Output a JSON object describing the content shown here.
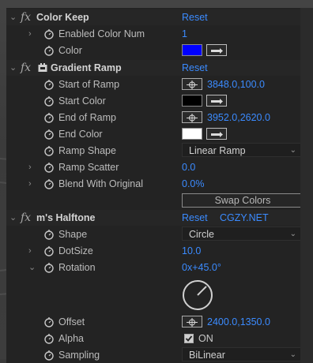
{
  "colors": {
    "panel_bg": "#232323",
    "value_blue": "#3b8bff",
    "color_keep_swatch": "#0000ff",
    "start_color_swatch": "#000000",
    "end_color_swatch": "#ffffff"
  },
  "effects": {
    "color_keep": {
      "name": "Color Keep",
      "reset": "Reset",
      "enabled_color_num_label": "Enabled Color Num",
      "enabled_color_num_value": "1",
      "color_label": "Color"
    },
    "gradient_ramp": {
      "name": "Gradient Ramp",
      "reset": "Reset",
      "start_of_ramp_label": "Start of Ramp",
      "start_of_ramp_value": "3848.0,100.0",
      "start_color_label": "Start Color",
      "end_of_ramp_label": "End of Ramp",
      "end_of_ramp_value": "3952.0,2620.0",
      "end_color_label": "End Color",
      "ramp_shape_label": "Ramp Shape",
      "ramp_shape_value": "Linear Ramp",
      "ramp_scatter_label": "Ramp Scatter",
      "ramp_scatter_value": "0.0",
      "blend_label": "Blend With Original",
      "blend_value": "0.0%",
      "swap_colors": "Swap Colors"
    },
    "halftone": {
      "name": "m's Halftone",
      "reset": "Reset",
      "credit": "CGZY.NET",
      "shape_label": "Shape",
      "shape_value": "Circle",
      "dotsize_label": "DotSize",
      "dotsize_value": "10.0",
      "rotation_label": "Rotation",
      "rotation_value": "0x+45.0°",
      "offset_label": "Offset",
      "offset_value": "2400.0,1350.0",
      "alpha_label": "Alpha",
      "alpha_value": "ON",
      "sampling_label": "Sampling",
      "sampling_value": "BiLinear"
    }
  },
  "icons": {
    "collapse": "chevron-down-icon",
    "expand": "chevron-right-icon",
    "stopwatch": "stopwatch-icon",
    "fx": "fx-icon",
    "plugin": "plugin-icon",
    "eyedropper": "eyedropper-icon",
    "crosshair": "crosshair-icon",
    "dial": "angle-dial-icon",
    "checkbox": "checkbox-checked-icon"
  }
}
